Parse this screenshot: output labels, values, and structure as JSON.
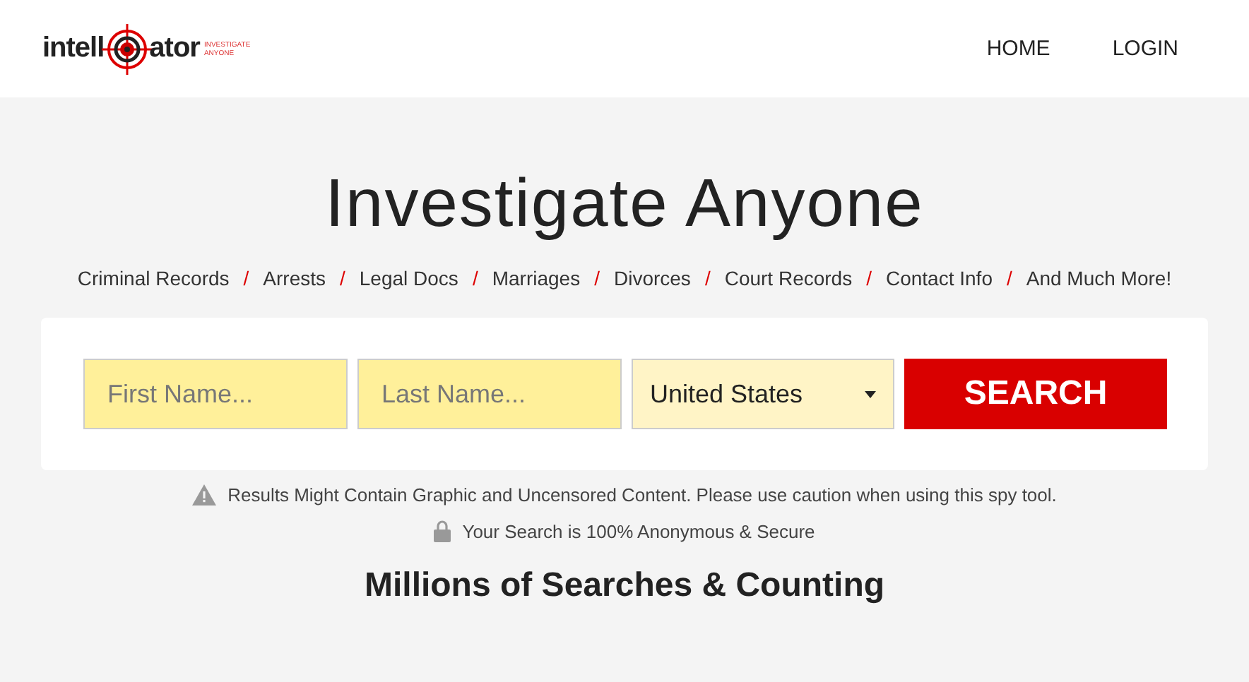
{
  "header": {
    "logo": {
      "left": "intell",
      "right": "ator",
      "tagline": [
        "INVESTIGATE",
        "ANYONE"
      ]
    },
    "nav": [
      "HOME",
      "LOGIN"
    ]
  },
  "hero": {
    "title": "Investigate Anyone",
    "separator": "/",
    "categories": [
      "Criminal Records",
      "Arrests",
      "Legal Docs",
      "Marriages",
      "Divorces",
      "Court Records",
      "Contact Info",
      "And Much More!"
    ]
  },
  "search": {
    "first_name": {
      "placeholder": "First Name..."
    },
    "last_name": {
      "placeholder": "Last Name..."
    },
    "country": {
      "value": "United States"
    },
    "button": "SEARCH"
  },
  "notices": [
    {
      "kind": "warning",
      "text": "Results Might Contain Graphic and Uncensored Content. Please use caution when using this spy tool."
    },
    {
      "kind": "lock",
      "text": "Your Search is 100% Anonymous & Secure"
    }
  ],
  "subheading": "Millions of Searches & Counting"
}
